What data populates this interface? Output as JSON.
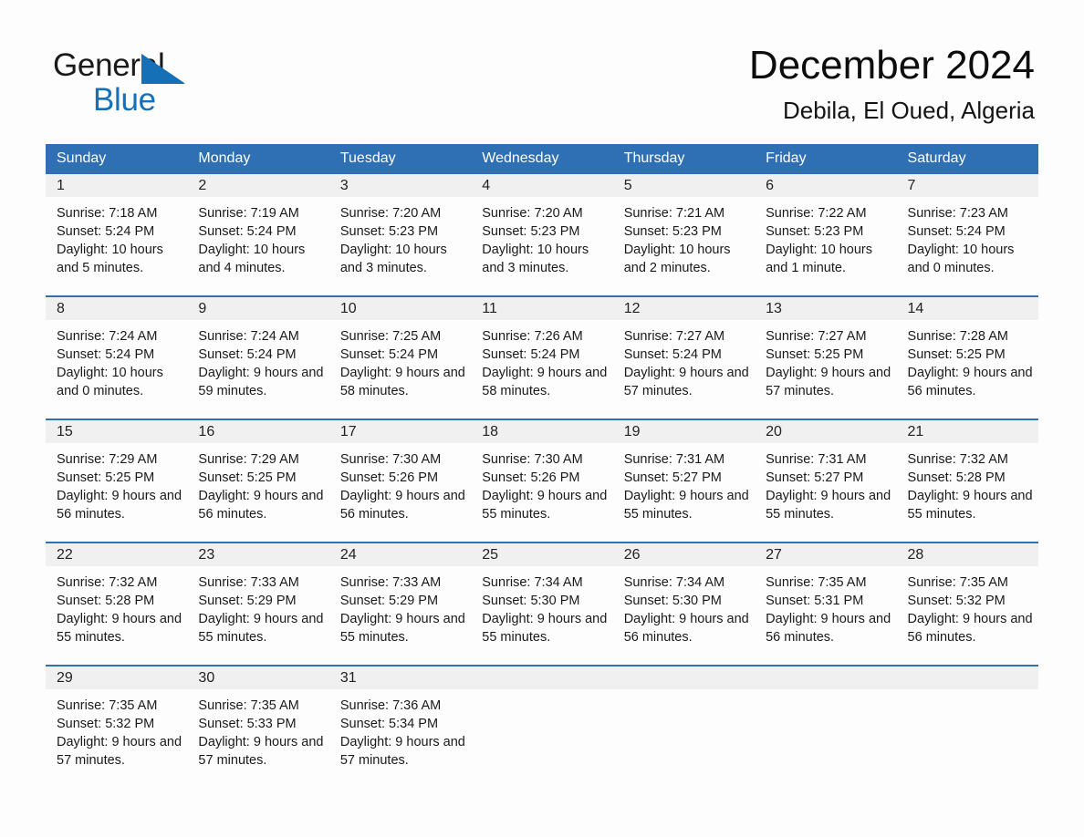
{
  "brand": {
    "word1": "General",
    "word2": "Blue",
    "triangle_color": "#1570b8",
    "blue_text_color": "#1570b8"
  },
  "header": {
    "month_title": "December 2024",
    "location": "Debila, El Oued, Algeria"
  },
  "theme": {
    "header_blue": "#2f70b4",
    "day_band_gray": "#f0f0f0",
    "page_background": "#fdfdfd"
  },
  "weekdays": [
    "Sunday",
    "Monday",
    "Tuesday",
    "Wednesday",
    "Thursday",
    "Friday",
    "Saturday"
  ],
  "weeks": [
    [
      {
        "day": "1",
        "sunrise": "Sunrise: 7:18 AM",
        "sunset": "Sunset: 5:24 PM",
        "daylight": "Daylight: 10 hours and 5 minutes."
      },
      {
        "day": "2",
        "sunrise": "Sunrise: 7:19 AM",
        "sunset": "Sunset: 5:24 PM",
        "daylight": "Daylight: 10 hours and 4 minutes."
      },
      {
        "day": "3",
        "sunrise": "Sunrise: 7:20 AM",
        "sunset": "Sunset: 5:23 PM",
        "daylight": "Daylight: 10 hours and 3 minutes."
      },
      {
        "day": "4",
        "sunrise": "Sunrise: 7:20 AM",
        "sunset": "Sunset: 5:23 PM",
        "daylight": "Daylight: 10 hours and 3 minutes."
      },
      {
        "day": "5",
        "sunrise": "Sunrise: 7:21 AM",
        "sunset": "Sunset: 5:23 PM",
        "daylight": "Daylight: 10 hours and 2 minutes."
      },
      {
        "day": "6",
        "sunrise": "Sunrise: 7:22 AM",
        "sunset": "Sunset: 5:23 PM",
        "daylight": "Daylight: 10 hours and 1 minute."
      },
      {
        "day": "7",
        "sunrise": "Sunrise: 7:23 AM",
        "sunset": "Sunset: 5:24 PM",
        "daylight": "Daylight: 10 hours and 0 minutes."
      }
    ],
    [
      {
        "day": "8",
        "sunrise": "Sunrise: 7:24 AM",
        "sunset": "Sunset: 5:24 PM",
        "daylight": "Daylight: 10 hours and 0 minutes."
      },
      {
        "day": "9",
        "sunrise": "Sunrise: 7:24 AM",
        "sunset": "Sunset: 5:24 PM",
        "daylight": "Daylight: 9 hours and 59 minutes."
      },
      {
        "day": "10",
        "sunrise": "Sunrise: 7:25 AM",
        "sunset": "Sunset: 5:24 PM",
        "daylight": "Daylight: 9 hours and 58 minutes."
      },
      {
        "day": "11",
        "sunrise": "Sunrise: 7:26 AM",
        "sunset": "Sunset: 5:24 PM",
        "daylight": "Daylight: 9 hours and 58 minutes."
      },
      {
        "day": "12",
        "sunrise": "Sunrise: 7:27 AM",
        "sunset": "Sunset: 5:24 PM",
        "daylight": "Daylight: 9 hours and 57 minutes."
      },
      {
        "day": "13",
        "sunrise": "Sunrise: 7:27 AM",
        "sunset": "Sunset: 5:25 PM",
        "daylight": "Daylight: 9 hours and 57 minutes."
      },
      {
        "day": "14",
        "sunrise": "Sunrise: 7:28 AM",
        "sunset": "Sunset: 5:25 PM",
        "daylight": "Daylight: 9 hours and 56 minutes."
      }
    ],
    [
      {
        "day": "15",
        "sunrise": "Sunrise: 7:29 AM",
        "sunset": "Sunset: 5:25 PM",
        "daylight": "Daylight: 9 hours and 56 minutes."
      },
      {
        "day": "16",
        "sunrise": "Sunrise: 7:29 AM",
        "sunset": "Sunset: 5:25 PM",
        "daylight": "Daylight: 9 hours and 56 minutes."
      },
      {
        "day": "17",
        "sunrise": "Sunrise: 7:30 AM",
        "sunset": "Sunset: 5:26 PM",
        "daylight": "Daylight: 9 hours and 56 minutes."
      },
      {
        "day": "18",
        "sunrise": "Sunrise: 7:30 AM",
        "sunset": "Sunset: 5:26 PM",
        "daylight": "Daylight: 9 hours and 55 minutes."
      },
      {
        "day": "19",
        "sunrise": "Sunrise: 7:31 AM",
        "sunset": "Sunset: 5:27 PM",
        "daylight": "Daylight: 9 hours and 55 minutes."
      },
      {
        "day": "20",
        "sunrise": "Sunrise: 7:31 AM",
        "sunset": "Sunset: 5:27 PM",
        "daylight": "Daylight: 9 hours and 55 minutes."
      },
      {
        "day": "21",
        "sunrise": "Sunrise: 7:32 AM",
        "sunset": "Sunset: 5:28 PM",
        "daylight": "Daylight: 9 hours and 55 minutes."
      }
    ],
    [
      {
        "day": "22",
        "sunrise": "Sunrise: 7:32 AM",
        "sunset": "Sunset: 5:28 PM",
        "daylight": "Daylight: 9 hours and 55 minutes."
      },
      {
        "day": "23",
        "sunrise": "Sunrise: 7:33 AM",
        "sunset": "Sunset: 5:29 PM",
        "daylight": "Daylight: 9 hours and 55 minutes."
      },
      {
        "day": "24",
        "sunrise": "Sunrise: 7:33 AM",
        "sunset": "Sunset: 5:29 PM",
        "daylight": "Daylight: 9 hours and 55 minutes."
      },
      {
        "day": "25",
        "sunrise": "Sunrise: 7:34 AM",
        "sunset": "Sunset: 5:30 PM",
        "daylight": "Daylight: 9 hours and 55 minutes."
      },
      {
        "day": "26",
        "sunrise": "Sunrise: 7:34 AM",
        "sunset": "Sunset: 5:30 PM",
        "daylight": "Daylight: 9 hours and 56 minutes."
      },
      {
        "day": "27",
        "sunrise": "Sunrise: 7:35 AM",
        "sunset": "Sunset: 5:31 PM",
        "daylight": "Daylight: 9 hours and 56 minutes."
      },
      {
        "day": "28",
        "sunrise": "Sunrise: 7:35 AM",
        "sunset": "Sunset: 5:32 PM",
        "daylight": "Daylight: 9 hours and 56 minutes."
      }
    ],
    [
      {
        "day": "29",
        "sunrise": "Sunrise: 7:35 AM",
        "sunset": "Sunset: 5:32 PM",
        "daylight": "Daylight: 9 hours and 57 minutes."
      },
      {
        "day": "30",
        "sunrise": "Sunrise: 7:35 AM",
        "sunset": "Sunset: 5:33 PM",
        "daylight": "Daylight: 9 hours and 57 minutes."
      },
      {
        "day": "31",
        "sunrise": "Sunrise: 7:36 AM",
        "sunset": "Sunset: 5:34 PM",
        "daylight": "Daylight: 9 hours and 57 minutes."
      },
      {
        "day": "",
        "sunrise": "",
        "sunset": "",
        "daylight": ""
      },
      {
        "day": "",
        "sunrise": "",
        "sunset": "",
        "daylight": ""
      },
      {
        "day": "",
        "sunrise": "",
        "sunset": "",
        "daylight": ""
      },
      {
        "day": "",
        "sunrise": "",
        "sunset": "",
        "daylight": ""
      }
    ]
  ]
}
